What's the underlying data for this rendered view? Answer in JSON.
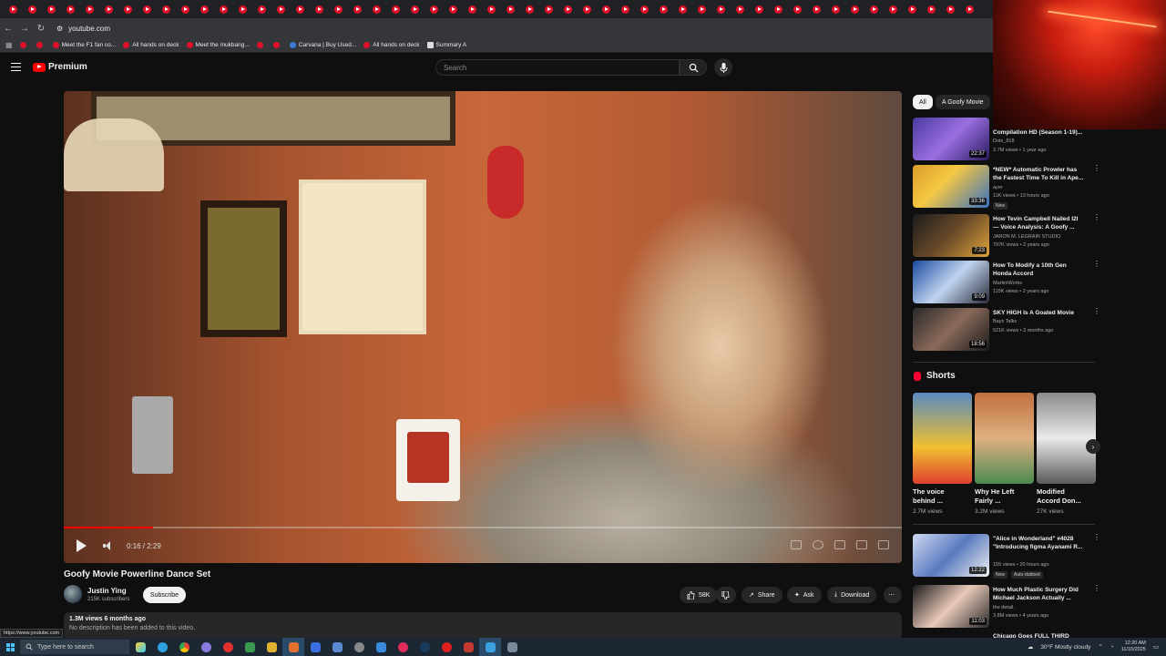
{
  "browser": {
    "url": "youtube.com",
    "bookmarks": [
      {
        "label": "",
        "color": "red"
      },
      {
        "label": "",
        "color": "red"
      },
      {
        "label": "Meet the F1 fan co...",
        "color": "red"
      },
      {
        "label": "All hands on deck",
        "color": "red"
      },
      {
        "label": "Meet the mukbang...",
        "color": "red"
      },
      {
        "label": "",
        "color": "red"
      },
      {
        "label": "",
        "color": "red"
      },
      {
        "label": "Carvana | Buy Used...",
        "color": "blue"
      },
      {
        "label": "All hands on deck",
        "color": "red"
      },
      {
        "label": "Summary A",
        "color": "gray"
      }
    ],
    "status_url": "https://www.youtube.com"
  },
  "header": {
    "logo_label": "Premium",
    "search_placeholder": "Search"
  },
  "video": {
    "title": "Goofy Movie Powerline Dance Set",
    "time": "0:16 / 2:29",
    "progress_fraction": 0.107,
    "channel": "Justin Ying",
    "subscribers": "215K subscribers",
    "subscribe_label": "Subscribe",
    "likes": "58K",
    "share_label": "Share",
    "ask_label": "Ask",
    "download_label": "Download",
    "views_date": "1.3M views  6 months ago",
    "description": "No description has been added to this video."
  },
  "sidebar": {
    "chips": [
      "All",
      "A Goofy Movie"
    ],
    "recommendations": [
      {
        "title": "Compilation HD (Season 1-19)...",
        "channel": "Dots_818",
        "meta": "2.7M views • 1 year ago",
        "duration": "22:37",
        "new": ""
      },
      {
        "title": "*NEW* Automatic Prowler has the Fastest Time To Kill in Ape...",
        "channel": "ayer",
        "meta": "11K views • 13 hours ago",
        "duration": "33:36",
        "new": "New"
      },
      {
        "title": "How Tevin Campbell Nailed I2I — Voice Analysis: A Goofy ...",
        "channel": "JARON M. LEGRAIR STUDIO",
        "meta": "797K views • 2 years ago",
        "duration": "7:23",
        "new": ""
      },
      {
        "title": "How To Modify a 10th Gen Honda Accord",
        "channel": "MartiniWorks",
        "meta": "115K views • 2 years ago",
        "duration": "9:09",
        "new": ""
      },
      {
        "title": "SKY HIGH Is A Goated Movie",
        "channel": "Bays Talks",
        "meta": "521K views • 3 months ago",
        "duration": "18:56",
        "new": ""
      }
    ],
    "shorts_label": "Shorts",
    "shorts": [
      {
        "title": "The voice behind ...",
        "views": "2.7M views"
      },
      {
        "title": "Why He Left Fairly ...",
        "views": "3.2M views"
      },
      {
        "title": "Modified Accord Don...",
        "views": "27K views"
      }
    ],
    "more_recommendations": [
      {
        "title": "\"Alice in Wonderland\" #4028 \"Introducing figma Ayanami R...",
        "channel": "",
        "meta": "155 views • 20 hours ago",
        "duration": "12:22",
        "new": "New",
        "badge": "Auto-dubbed"
      },
      {
        "title": "How Much Plastic Surgery Did Michael Jackson Actually ...",
        "channel": "the detail.",
        "meta": "3.8M views • 4 years ago",
        "duration": "11:03",
        "new": ""
      },
      {
        "title": "Chicago Goes FULL THIRD",
        "channel": "",
        "meta": "",
        "duration": "",
        "new": ""
      }
    ]
  },
  "taskbar": {
    "search_placeholder": "Type here to search",
    "weather": "30°F  Mostly cloudy",
    "time": "12:20 AM",
    "date": "11/10/2025"
  },
  "colors": {
    "accent": "#ff0000",
    "background": "#0f0f0f"
  }
}
